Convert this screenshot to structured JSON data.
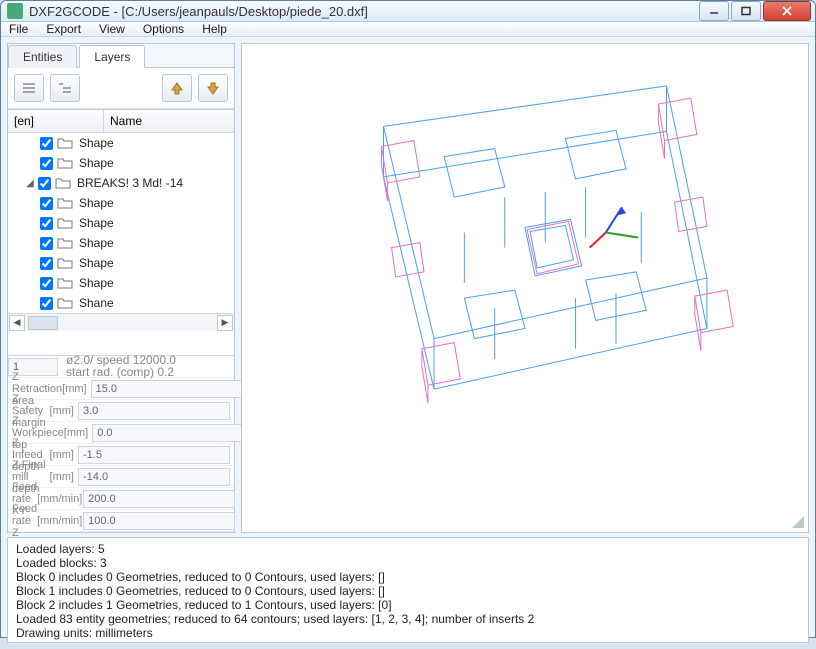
{
  "window": {
    "title": "DXF2GCODE - [C:/Users/jeanpauls/Desktop/piede_20.dxf]"
  },
  "menu": {
    "file": "File",
    "export": "Export",
    "view": "View",
    "options": "Options",
    "help": "Help"
  },
  "tabs": {
    "entities": "Entities",
    "layers": "Layers"
  },
  "tree": {
    "header_en": "[en]",
    "header_name": "Name",
    "rows": [
      {
        "name": "Shape"
      },
      {
        "name": "Shape"
      },
      {
        "name": "BREAKS! 3 Md! -14",
        "group": true
      },
      {
        "name": "Shape"
      },
      {
        "name": "Shape"
      },
      {
        "name": "Shape"
      },
      {
        "name": "Shape"
      },
      {
        "name": "Shape"
      },
      {
        "name": "Shane"
      }
    ]
  },
  "params": {
    "top_spinner": "1",
    "top_info_l1": "ø2.0/ speed 12000.0",
    "top_info_l2": "start rad. (comp) 0.2",
    "rows": [
      {
        "label": "Z Retraction area",
        "unit": "[mm]",
        "value": "15.0"
      },
      {
        "label": "Z Safety margin",
        "unit": "[mm]",
        "value": "3.0"
      },
      {
        "label": "Z Workpiece top",
        "unit": "[mm]",
        "value": "0.0"
      },
      {
        "label": "Z Infeed depth",
        "unit": "[mm]",
        "value": "-1.5"
      },
      {
        "label": "Z Final mill depth",
        "unit": "[mm]",
        "value": "-14.0"
      },
      {
        "label": "Feed rate XY",
        "unit": "[mm/min]",
        "value": "200.0"
      },
      {
        "label": "Feed rate Z",
        "unit": "[mm/min]",
        "value": "100.0"
      }
    ]
  },
  "console": {
    "l1": "Loaded layers: 5",
    "l2": "Loaded blocks: 3",
    "l3": "Block 0 includes 0 Geometries, reduced to 0 Contours, used layers: []",
    "l4": "Block 1 includes 0 Geometries, reduced to 0 Contours, used layers: []",
    "l5": "Block 2 includes 1 Geometries, reduced to 1 Contours, used layers: [0]",
    "l6": "Loaded 83 entity geometries; reduced to 64 contours; used layers: [1, 2, 3, 4]; number of inserts 2",
    "l7": "Drawing units: millimeters"
  }
}
